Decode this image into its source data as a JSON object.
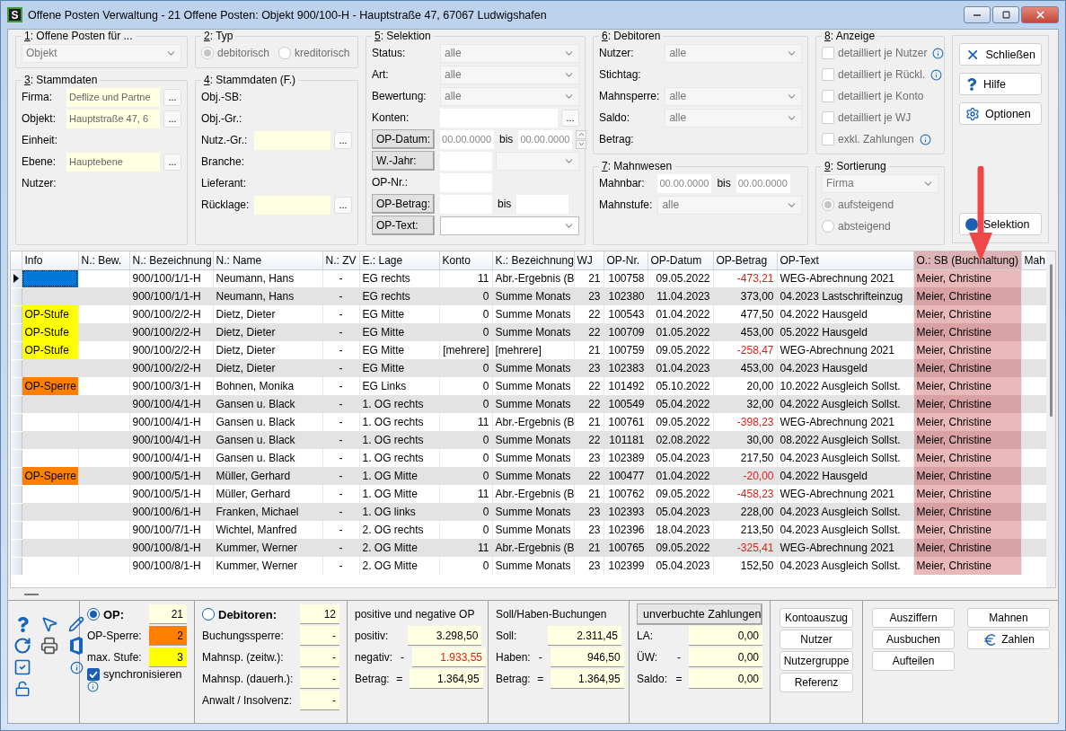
{
  "window": {
    "icon_letter": "S",
    "title": "Offene Posten Verwaltung - 21 Offene Posten: Objekt 900/100-H - Hauptstraße 47, 67067 Ludwigshafen"
  },
  "filter_columns": [
    [
      {
        "title": "1: Offene Posten für ...",
        "rows": [
          {
            "kind": "fields",
            "fields": [
              {
                "kind": "select",
                "value": "Objekt",
                "disabled": true
              }
            ]
          }
        ]
      },
      {
        "title": "3: Stammdaten",
        "rows": [
          {
            "kind": "fields",
            "label": "Firma:",
            "fields": [
              {
                "kind": "lookup",
                "value": "Deflize und Partne",
                "button": "..."
              }
            ]
          },
          {
            "kind": "fields",
            "label": "Objekt:",
            "fields": [
              {
                "kind": "lookup",
                "value": "Hauptstraße 47, 6",
                "button": "..."
              }
            ]
          },
          {
            "kind": "fields",
            "label": "Einheit:"
          },
          {
            "kind": "fields",
            "label": "Ebene:",
            "fields": [
              {
                "kind": "lookup",
                "value": "Hauptebene",
                "button": "..."
              }
            ]
          },
          {
            "kind": "fields",
            "label": "Nutzer:"
          }
        ]
      }
    ],
    [
      {
        "title": "2: Typ",
        "rows": [
          {
            "kind": "radios",
            "disabled": true,
            "options": [
              {
                "label": "debitorisch",
                "selected": true
              },
              {
                "label": "kreditorisch",
                "selected": false
              }
            ]
          }
        ]
      },
      {
        "title": "4: Stammdaten (F.)",
        "rows": [
          {
            "kind": "fields",
            "label": "Obj.-SB:"
          },
          {
            "kind": "fields",
            "label": "Obj.-Gr.:"
          },
          {
            "kind": "fields",
            "label": "Nutz.-Gr.:",
            "fields": [
              {
                "kind": "lookup",
                "button": "..."
              }
            ]
          },
          {
            "kind": "fields",
            "label": "Branche:"
          },
          {
            "kind": "fields",
            "label": "Lieferant:"
          },
          {
            "kind": "fields",
            "label": "Rücklage:",
            "fields": [
              {
                "kind": "lookup",
                "button": "..."
              }
            ]
          }
        ]
      }
    ],
    [
      {
        "title": "5: Selektion",
        "rows": [
          {
            "kind": "fields",
            "label": "Status:",
            "fields": [
              {
                "kind": "select",
                "value": "alle",
                "disabled": true
              }
            ]
          },
          {
            "kind": "fields",
            "label": "Art:",
            "fields": [
              {
                "kind": "select",
                "value": "alle",
                "disabled": true
              }
            ]
          },
          {
            "kind": "fields",
            "label": "Bewertung:",
            "fields": [
              {
                "kind": "select",
                "value": "alle",
                "disabled": true
              }
            ]
          },
          {
            "kind": "fields",
            "label": "Konten:",
            "fields": [
              {
                "kind": "browse",
                "button": "..."
              }
            ]
          },
          {
            "kind": "fields",
            "label": "OP-Datum:",
            "label_button": true,
            "fields": [
              {
                "kind": "date",
                "placeholder": "00.00.0000"
              },
              {
                "kind": "sep",
                "text": "bis"
              },
              {
                "kind": "date",
                "placeholder": "00.00.0000"
              },
              {
                "kind": "spinner"
              }
            ]
          },
          {
            "kind": "fields",
            "label": "W.-Jahr:",
            "label_button": true,
            "fields": [
              {
                "kind": "input"
              },
              {
                "kind": "select",
                "disabled": true
              }
            ]
          },
          {
            "kind": "fields",
            "label": "OP-Nr.:",
            "label_button": false,
            "fields": [
              {
                "kind": "input"
              }
            ]
          },
          {
            "kind": "fields",
            "label": "OP-Betrag:",
            "label_button": true,
            "fields": [
              {
                "kind": "input"
              },
              {
                "kind": "sep",
                "text": "bis"
              },
              {
                "kind": "input"
              }
            ]
          },
          {
            "kind": "fields",
            "label": "OP-Text:",
            "label_button": true,
            "fields": [
              {
                "kind": "select",
                "disabled": false
              }
            ]
          }
        ]
      }
    ],
    [
      {
        "title": "6: Debitoren",
        "rows": [
          {
            "kind": "fields",
            "label": "Nutzer:",
            "fields": [
              {
                "kind": "select",
                "value": "alle",
                "disabled": true
              }
            ]
          },
          {
            "kind": "fields",
            "label": "Stichtag:"
          },
          {
            "kind": "fields",
            "label": "Mahnsperre:",
            "fields": [
              {
                "kind": "select",
                "value": "alle",
                "disabled": true
              }
            ]
          },
          {
            "kind": "fields",
            "label": "Saldo:",
            "fields": [
              {
                "kind": "select",
                "value": "alle",
                "disabled": true
              }
            ]
          },
          {
            "kind": "fields",
            "label": "Betrag:"
          }
        ]
      },
      {
        "title": "7: Mahnwesen",
        "rows": [
          {
            "kind": "fields",
            "label": "Mahnbar:",
            "fields": [
              {
                "kind": "date",
                "placeholder": "00.00.0000"
              },
              {
                "kind": "sep",
                "text": "bis"
              },
              {
                "kind": "date",
                "placeholder": "00.00.0000"
              }
            ]
          },
          {
            "kind": "fields",
            "label": "Mahnstufe:",
            "fields": [
              {
                "kind": "select",
                "value": "alle",
                "disabled": true
              }
            ]
          }
        ]
      }
    ],
    [
      {
        "title": "8: Anzeige",
        "rows": [
          {
            "kind": "checkbox",
            "label": "detailliert je Nutzer",
            "checked": false,
            "disabled": true,
            "info": true
          },
          {
            "kind": "checkbox",
            "label": "detailliert je Rückl.",
            "checked": false,
            "disabled": true,
            "info": true
          },
          {
            "kind": "checkbox",
            "label": "detailliert je Konto",
            "checked": false,
            "disabled": true,
            "info": false
          },
          {
            "kind": "checkbox",
            "label": "detailliert je WJ",
            "checked": false,
            "disabled": true,
            "info": false
          },
          {
            "kind": "checkbox",
            "label": "exkl. Zahlungen",
            "checked": false,
            "disabled": true,
            "info": true
          }
        ]
      },
      {
        "title": "9: Sortierung",
        "rows": [
          {
            "kind": "fields",
            "fields": [
              {
                "kind": "select",
                "value": "Firma",
                "disabled": true
              }
            ]
          },
          {
            "kind": "radio",
            "label": "aufsteigend",
            "selected": true,
            "disabled": true
          },
          {
            "kind": "radio",
            "label": "absteigend",
            "selected": false,
            "disabled": true
          }
        ]
      }
    ]
  ],
  "command_buttons": [
    {
      "label": "Schließen",
      "kind": "close"
    },
    {
      "label": "Hilfe",
      "kind": "help"
    },
    {
      "label": "Optionen",
      "kind": "options"
    }
  ],
  "selection_button": {
    "label": "Selektion"
  },
  "table": {
    "columns": [
      {
        "label": "Info"
      },
      {
        "label": "N.: Bew."
      },
      {
        "label": "N.: Bezeichnung"
      },
      {
        "label": "N.: Name"
      },
      {
        "label": "N.: ZV"
      },
      {
        "label": "E.: Lage"
      },
      {
        "label": "Konto"
      },
      {
        "label": "K.: Bezeichnung"
      },
      {
        "label": "WJ"
      },
      {
        "label": "OP-Nr."
      },
      {
        "label": "OP-Datum"
      },
      {
        "label": "OP-Betrag"
      },
      {
        "label": "OP-Text"
      },
      {
        "label": "O.: SB (Buchhaltung)",
        "highlighted": true
      },
      {
        "label": "Mah"
      }
    ],
    "rows": [
      {
        "selected": true,
        "bezeichnung": "900/100/1/1-H",
        "name": "Neumann, Hans",
        "zv": "-",
        "lage": "EG rechts",
        "konto": "11",
        "k_bezeichnung": "Abr.-Ergebnis (B",
        "wj": "21",
        "op_nr": "100758",
        "op_datum": "09.05.2022",
        "op_betrag": "-473,21",
        "negative": true,
        "op_text": "WEG-Abrechnung 2021",
        "sb": "Meier, Christine"
      },
      {
        "selected": false,
        "bezeichnung": "900/100/1/1-H",
        "name": "Neumann, Hans",
        "zv": "-",
        "lage": "EG rechts",
        "konto": "0",
        "k_bezeichnung": "Summe Monats",
        "wj": "23",
        "op_nr": "102380",
        "op_datum": "11.04.2023",
        "op_betrag": "373,00",
        "negative": false,
        "op_text": "04.2023 Lastschrifteinzug",
        "sb": "Meier, Christine"
      },
      {
        "selected": false,
        "info": "OP-Stufe",
        "color": "#ffff00",
        "bezeichnung": "900/100/2/2-H",
        "name": "Dietz, Dieter",
        "zv": "-",
        "lage": "EG Mitte",
        "konto": "0",
        "k_bezeichnung": "Summe Monats",
        "wj": "22",
        "op_nr": "100543",
        "op_datum": "01.04.2022",
        "op_betrag": "477,50",
        "negative": false,
        "op_text": "04.2022 Hausgeld",
        "sb": "Meier, Christine"
      },
      {
        "selected": false,
        "info": "OP-Stufe",
        "color": "#ffff00",
        "bezeichnung": "900/100/2/2-H",
        "name": "Dietz, Dieter",
        "zv": "-",
        "lage": "EG Mitte",
        "konto": "0",
        "k_bezeichnung": "Summe Monats",
        "wj": "22",
        "op_nr": "100709",
        "op_datum": "01.05.2022",
        "op_betrag": "453,00",
        "negative": false,
        "op_text": "05.2022 Hausgeld",
        "sb": "Meier, Christine"
      },
      {
        "selected": false,
        "info": "OP-Stufe",
        "color": "#ffff00",
        "bezeichnung": "900/100/2/2-H",
        "name": "Dietz, Dieter",
        "zv": "-",
        "lage": "EG Mitte",
        "konto": "[mehrere]",
        "k_bezeichnung": "[mehrere]",
        "wj": "21",
        "op_nr": "100759",
        "op_datum": "09.05.2022",
        "op_betrag": "-258,47",
        "negative": true,
        "op_text": "WEG-Abrechnung 2021",
        "sb": "Meier, Christine"
      },
      {
        "selected": false,
        "bezeichnung": "900/100/2/2-H",
        "name": "Dietz, Dieter",
        "zv": "-",
        "lage": "EG Mitte",
        "konto": "0",
        "k_bezeichnung": "Summe Monats",
        "wj": "23",
        "op_nr": "102383",
        "op_datum": "01.04.2023",
        "op_betrag": "453,00",
        "negative": false,
        "op_text": "04.2023 Hausgeld",
        "sb": "Meier, Christine"
      },
      {
        "selected": false,
        "info": "OP-Sperre",
        "color": "#ff8000",
        "bezeichnung": "900/100/3/1-H",
        "name": "Bohnen, Monika",
        "zv": "-",
        "lage": "EG Links",
        "konto": "0",
        "k_bezeichnung": "Summe Monats",
        "wj": "22",
        "op_nr": "101492",
        "op_datum": "05.10.2022",
        "op_betrag": "20,00",
        "negative": false,
        "op_text": "10.2022 Ausgleich Sollst.",
        "sb": "Meier, Christine"
      },
      {
        "selected": false,
        "bezeichnung": "900/100/4/1-H",
        "name": "Gansen u. Black",
        "zv": "-",
        "lage": "1. OG rechts",
        "konto": "0",
        "k_bezeichnung": "Summe Monats",
        "wj": "22",
        "op_nr": "100549",
        "op_datum": "05.04.2022",
        "op_betrag": "32,00",
        "negative": false,
        "op_text": "04.2022 Ausgleich Sollst.",
        "sb": "Meier, Christine"
      },
      {
        "selected": false,
        "bezeichnung": "900/100/4/1-H",
        "name": "Gansen u. Black",
        "zv": "-",
        "lage": "1. OG rechts",
        "konto": "11",
        "k_bezeichnung": "Abr.-Ergebnis (B",
        "wj": "21",
        "op_nr": "100761",
        "op_datum": "09.05.2022",
        "op_betrag": "-398,23",
        "negative": true,
        "op_text": "WEG-Abrechnung 2021",
        "sb": "Meier, Christine"
      },
      {
        "selected": false,
        "bezeichnung": "900/100/4/1-H",
        "name": "Gansen u. Black",
        "zv": "-",
        "lage": "1. OG rechts",
        "konto": "0",
        "k_bezeichnung": "Summe Monats",
        "wj": "22",
        "op_nr": "101181",
        "op_datum": "02.08.2022",
        "op_betrag": "30,00",
        "negative": false,
        "op_text": "08.2022 Ausgleich Sollst.",
        "sb": "Meier, Christine"
      },
      {
        "selected": false,
        "bezeichnung": "900/100/4/1-H",
        "name": "Gansen u. Black",
        "zv": "-",
        "lage": "1. OG rechts",
        "konto": "0",
        "k_bezeichnung": "Summe Monats",
        "wj": "23",
        "op_nr": "102389",
        "op_datum": "05.04.2023",
        "op_betrag": "217,50",
        "negative": false,
        "op_text": "04.2023 Ausgleich Sollst.",
        "sb": "Meier, Christine"
      },
      {
        "selected": false,
        "info": "OP-Sperre",
        "color": "#ff8000",
        "bezeichnung": "900/100/5/1-H",
        "name": "Müller, Gerhard",
        "zv": "-",
        "lage": "1. OG Mitte",
        "konto": "0",
        "k_bezeichnung": "Summe Monats",
        "wj": "22",
        "op_nr": "100477",
        "op_datum": "01.04.2022",
        "op_betrag": "-20,00",
        "negative": true,
        "op_text": "04.2022 Hausgeld",
        "sb": "Meier, Christine"
      },
      {
        "selected": false,
        "bezeichnung": "900/100/5/1-H",
        "name": "Müller, Gerhard",
        "zv": "-",
        "lage": "1. OG Mitte",
        "konto": "11",
        "k_bezeichnung": "Abr.-Ergebnis (B",
        "wj": "21",
        "op_nr": "100762",
        "op_datum": "09.05.2022",
        "op_betrag": "-458,23",
        "negative": true,
        "op_text": "WEG-Abrechnung 2021",
        "sb": "Meier, Christine"
      },
      {
        "selected": false,
        "bezeichnung": "900/100/6/1-H",
        "name": "Franken, Michael",
        "zv": "-",
        "lage": "1. OG links",
        "konto": "0",
        "k_bezeichnung": "Summe Monats",
        "wj": "23",
        "op_nr": "102393",
        "op_datum": "05.04.2023",
        "op_betrag": "228,00",
        "negative": false,
        "op_text": "04.2023 Ausgleich Sollst.",
        "sb": "Meier, Christine"
      },
      {
        "selected": false,
        "bezeichnung": "900/100/7/1-H",
        "name": "Wichtel, Manfred",
        "zv": "-",
        "lage": "2. OG rechts",
        "konto": "0",
        "k_bezeichnung": "Summe Monats",
        "wj": "23",
        "op_nr": "102396",
        "op_datum": "18.04.2023",
        "op_betrag": "213,50",
        "negative": false,
        "op_text": "04.2023 Ausgleich Sollst.",
        "sb": "Meier, Christine"
      },
      {
        "selected": false,
        "bezeichnung": "900/100/8/1-H",
        "name": "Kummer, Werner",
        "zv": "-",
        "lage": "2. OG Mitte",
        "konto": "11",
        "k_bezeichnung": "Abr.-Ergebnis (B",
        "wj": "21",
        "op_nr": "100765",
        "op_datum": "09.05.2022",
        "op_betrag": "-325,41",
        "negative": true,
        "op_text": "WEG-Abrechnung 2021",
        "sb": "Meier, Christine"
      },
      {
        "selected": false,
        "bezeichnung": "900/100/8/1-H",
        "name": "Kummer, Werner",
        "zv": "-",
        "lage": "2. OG Mitte",
        "konto": "0",
        "k_bezeichnung": "Summe Monats",
        "wj": "23",
        "op_nr": "102399",
        "op_datum": "05.04.2023",
        "op_betrag": "152,50",
        "negative": false,
        "op_text": "04.2023 Ausgleich Sollst.",
        "sb": "Meier, Christine"
      }
    ]
  },
  "op_panel": {
    "radio": {
      "label": "OP:",
      "selected": true,
      "value": "21"
    },
    "rows": [
      {
        "label": "OP-Sperre:",
        "value": "2",
        "color": "#ff8000"
      },
      {
        "label": "max. Stufe:",
        "value": "3",
        "color": "#ffff00"
      }
    ],
    "sync": {
      "label": "synchronisieren",
      "checked": true
    }
  },
  "debitoren_panel": {
    "radio": {
      "label": "Debitoren:",
      "selected": false,
      "value": "12"
    },
    "rows": [
      {
        "label": "Buchungssperre:",
        "value": "-"
      },
      {
        "label": "Mahnsp. (zeitw.):",
        "value": "-"
      },
      {
        "label": "Mahnsp. (dauerh.):",
        "value": "-"
      },
      {
        "label": "Anwalt / Insolvenz:",
        "value": "-"
      }
    ]
  },
  "totals": [
    {
      "kind": "title",
      "title": "positive und negative OP",
      "rows": [
        {
          "label": "positiv:",
          "value": "3.298,50",
          "negative": false
        },
        {
          "label": "negativ:",
          "op": "-",
          "value": "1.933,55",
          "negative": true
        },
        {
          "label": "Betrag:",
          "op": "=",
          "value": "1.364,95",
          "negative": false
        }
      ]
    },
    {
      "kind": "title",
      "title": "Soll/Haben-Buchungen",
      "rows": [
        {
          "label": "Soll:",
          "value": "2.311,45",
          "negative": false
        },
        {
          "label": "Haben:",
          "op": "-",
          "value": "946,50",
          "negative": false
        },
        {
          "label": "Betrag:",
          "op": "=",
          "value": "1.364,95",
          "negative": false
        }
      ]
    },
    {
      "kind": "button",
      "title": "unverbuchte Zahlungen",
      "rows": [
        {
          "label": "LA:",
          "value": "0,00",
          "negative": false
        },
        {
          "label": "ÜW:",
          "op": "-",
          "value": "0,00",
          "negative": false
        },
        {
          "label": "Saldo:",
          "op": "=",
          "value": "0,00",
          "negative": false
        }
      ]
    }
  ],
  "side_buttons": [
    "Kontoauszug",
    "Nutzer",
    "Nutzergruppe",
    "Referenz"
  ],
  "action_buttons": [
    {
      "label": "Ausziffern",
      "kind": "plain"
    },
    {
      "label": "Mahnen",
      "kind": "plain"
    },
    {
      "label": "Ausbuchen",
      "kind": "plain"
    },
    {
      "label": "Zahlen",
      "kind": "euro"
    },
    {
      "label": "Aufteilen",
      "kind": "plain"
    }
  ]
}
